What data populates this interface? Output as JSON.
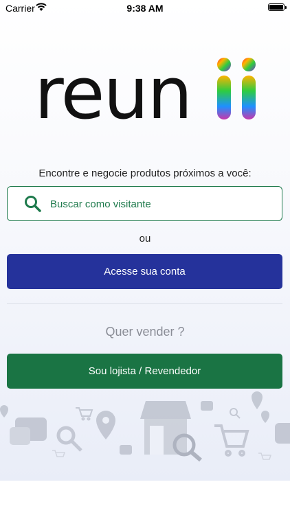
{
  "status_bar": {
    "carrier": "Carrier",
    "time": "9:38 AM",
    "battery_level": 1.0
  },
  "logo": {
    "text": "reunii",
    "colors": {
      "text": "#111111",
      "gradient": [
        "#ff2d2d",
        "#ffb300",
        "#2ecc40",
        "#1e90ff",
        "#c837ab"
      ]
    }
  },
  "tagline": "Encontre e negocie produtos próximos a você:",
  "search": {
    "label": "Buscar como visitante",
    "icon": "search-icon"
  },
  "or_text": "ou",
  "login_button": {
    "label": "Acesse sua conta"
  },
  "sell_question": "Quer vender ?",
  "seller_button": {
    "label": "Sou lojista / Revendedor"
  },
  "colors": {
    "primary_blue": "#25329b",
    "primary_green": "#1a7444",
    "outline_green": "#1e7a4c",
    "footer_icons": "#9aa0ad"
  },
  "footer_icons": [
    "chat-icon",
    "search-icon",
    "location-pin-icon",
    "cart-icon",
    "store-search-icon",
    "shopping-cart-icon"
  ]
}
